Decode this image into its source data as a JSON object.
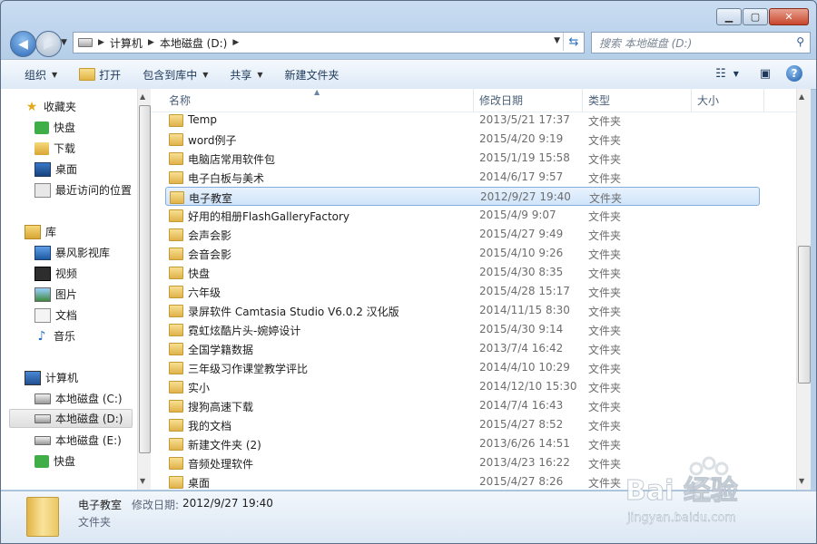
{
  "address": {
    "crumbs": [
      "计算机",
      "本地磁盘 (D:)"
    ]
  },
  "search": {
    "placeholder": "搜索 本地磁盘 (D:)"
  },
  "toolbar": {
    "organize": "组织",
    "open": "打开",
    "include": "包含到库中",
    "share": "共享",
    "new_folder": "新建文件夹"
  },
  "nav": {
    "favorites": "收藏夹",
    "fav_items": [
      "快盘",
      "下载",
      "桌面",
      "最近访问的位置"
    ],
    "libraries": "库",
    "lib_items": [
      "暴风影视库",
      "视频",
      "图片",
      "文档",
      "音乐"
    ],
    "computer": "计算机",
    "comp_items": [
      "本地磁盘 (C:)",
      "本地磁盘 (D:)",
      "本地磁盘 (E:)",
      "快盘"
    ]
  },
  "columns": {
    "name": "名称",
    "modified": "修改日期",
    "type": "类型",
    "size": "大小"
  },
  "files": [
    {
      "name": "Temp",
      "date": "2013/5/21 17:37",
      "type": "文件夹"
    },
    {
      "name": "word例子",
      "date": "2015/4/20 9:19",
      "type": "文件夹"
    },
    {
      "name": "电脑店常用软件包",
      "date": "2015/1/19 15:58",
      "type": "文件夹"
    },
    {
      "name": "电子白板与美术",
      "date": "2014/6/17 9:57",
      "type": "文件夹"
    },
    {
      "name": "电子教室",
      "date": "2012/9/27 19:40",
      "type": "文件夹"
    },
    {
      "name": "好用的相册FlashGalleryFactory",
      "date": "2015/4/9 9:07",
      "type": "文件夹"
    },
    {
      "name": "会声会影",
      "date": "2015/4/27 9:49",
      "type": "文件夹"
    },
    {
      "name": "会音会影",
      "date": "2015/4/10 9:26",
      "type": "文件夹"
    },
    {
      "name": "快盘",
      "date": "2015/4/30 8:35",
      "type": "文件夹"
    },
    {
      "name": "六年级",
      "date": "2015/4/28 15:17",
      "type": "文件夹"
    },
    {
      "name": "录屏软件 Camtasia Studio V6.0.2 汉化版",
      "date": "2014/11/15 8:30",
      "type": "文件夹"
    },
    {
      "name": "霓虹炫酷片头-婉婷设计",
      "date": "2015/4/30 9:14",
      "type": "文件夹"
    },
    {
      "name": "全国学籍数据",
      "date": "2013/7/4 16:42",
      "type": "文件夹"
    },
    {
      "name": "三年级习作课堂教学评比",
      "date": "2014/4/10 10:29",
      "type": "文件夹"
    },
    {
      "name": "实小",
      "date": "2014/12/10 15:30",
      "type": "文件夹"
    },
    {
      "name": "搜狗高速下载",
      "date": "2014/7/4 16:43",
      "type": "文件夹"
    },
    {
      "name": "我的文档",
      "date": "2015/4/27 8:52",
      "type": "文件夹"
    },
    {
      "name": "新建文件夹 (2)",
      "date": "2013/6/26 14:51",
      "type": "文件夹"
    },
    {
      "name": "音频处理软件",
      "date": "2013/4/23 16:22",
      "type": "文件夹"
    },
    {
      "name": "桌面",
      "date": "2015/4/27 8:26",
      "type": "文件夹"
    }
  ],
  "details": {
    "name": "电子教室",
    "modified_label": "修改日期:",
    "modified": "2012/9/27 19:40",
    "type": "文件夹"
  },
  "watermark": {
    "logo": "Bai 经验",
    "url": "jingyan.baidu.com"
  }
}
